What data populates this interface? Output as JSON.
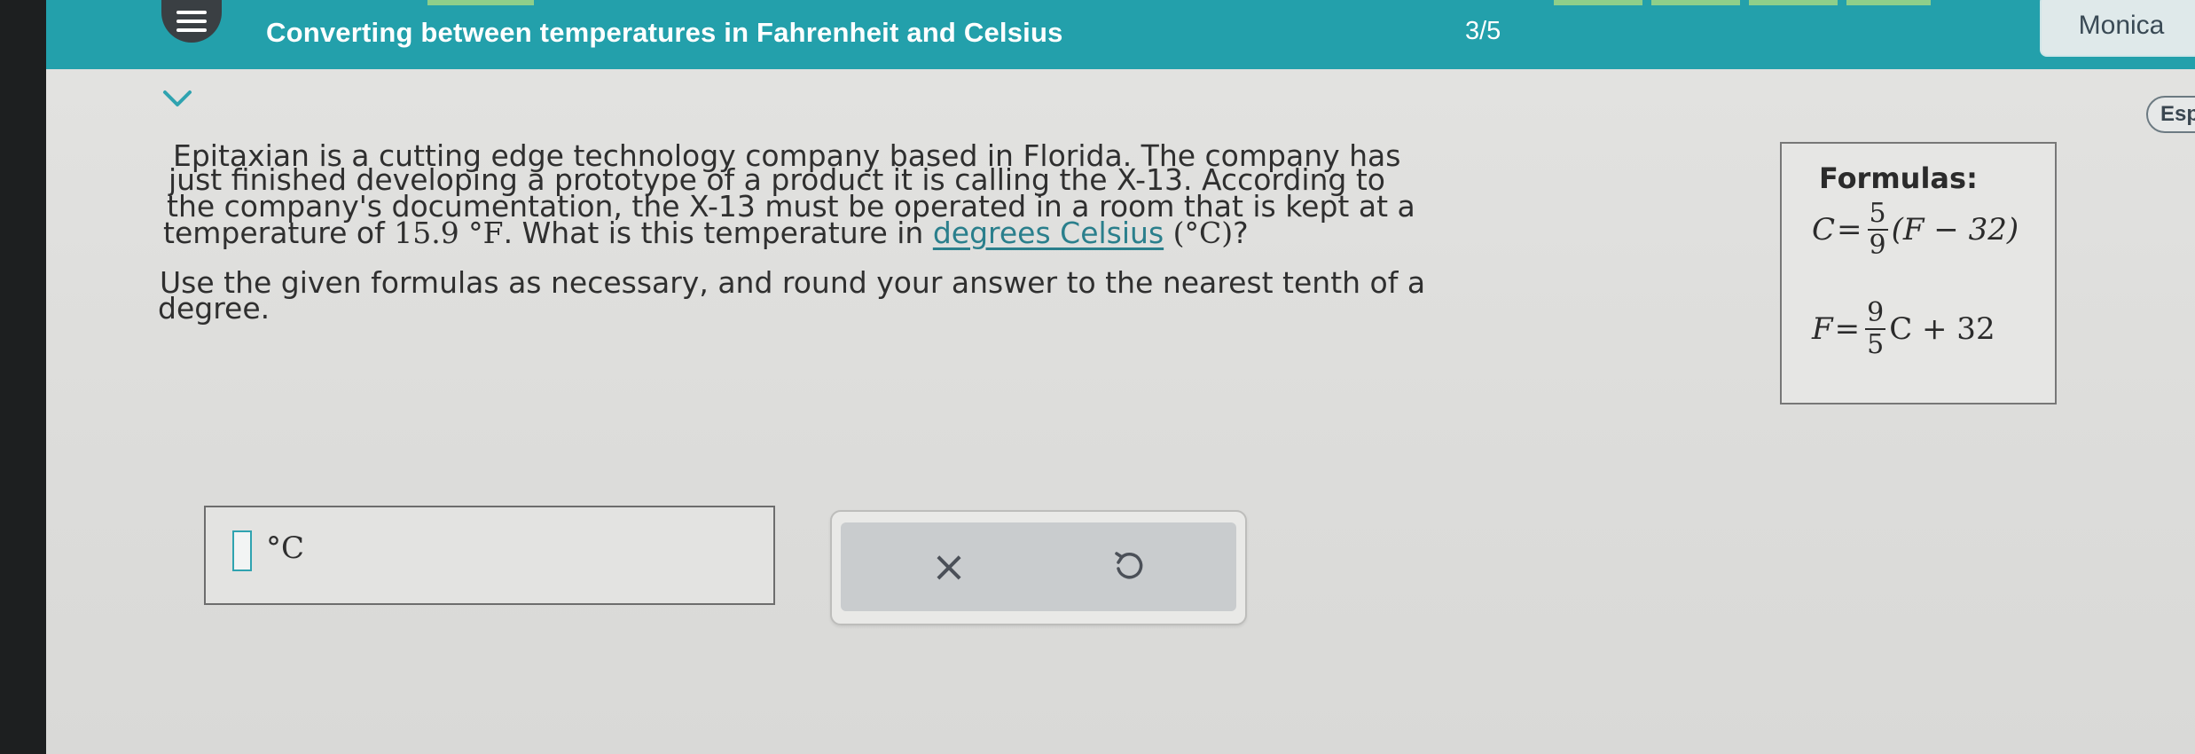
{
  "header": {
    "title": "Converting between temperatures in Fahrenheit and Celsius",
    "counter": "3/5",
    "user": "Monica",
    "menu_icon": "hamburger-menu-icon",
    "accent_color": "#23a0ab"
  },
  "toolbar": {
    "language_button": "Esp",
    "collapse_icon": "chevron-down-icon"
  },
  "problem": {
    "line1": "Epitaxian is a cutting edge technology company based in Florida. The company has",
    "line2": "just finished developing a prototype of a product it is calling the X-13. According to",
    "line3": "the company's documentation, the X-13 must be operated in a room that is kept at a",
    "line4_prefix": "temperature of ",
    "temp_value": "15.9 °F",
    "line4_mid": ". What is this temperature in ",
    "link_text": "degrees Celsius",
    "line4_unit": "(°C)",
    "line4_suffix": "?",
    "instruction_line1": "Use the given formulas as necessary, and round your answer to the nearest tenth of a",
    "instruction_line2": "degree."
  },
  "formulas": {
    "title": "Formulas:",
    "f1_lhs": "C",
    "f1_eq": "=",
    "f1_num": "5",
    "f1_den": "9",
    "f1_rhs": "(F − 32)",
    "f2_lhs": "F",
    "f2_eq": "=",
    "f2_num": "9",
    "f2_den": "5",
    "f2_rhs": "C + 32"
  },
  "answer": {
    "value": "",
    "unit": "°C"
  },
  "actions": {
    "clear_label": "×",
    "clear_icon": "clear-x-icon",
    "undo_icon": "undo-icon"
  }
}
